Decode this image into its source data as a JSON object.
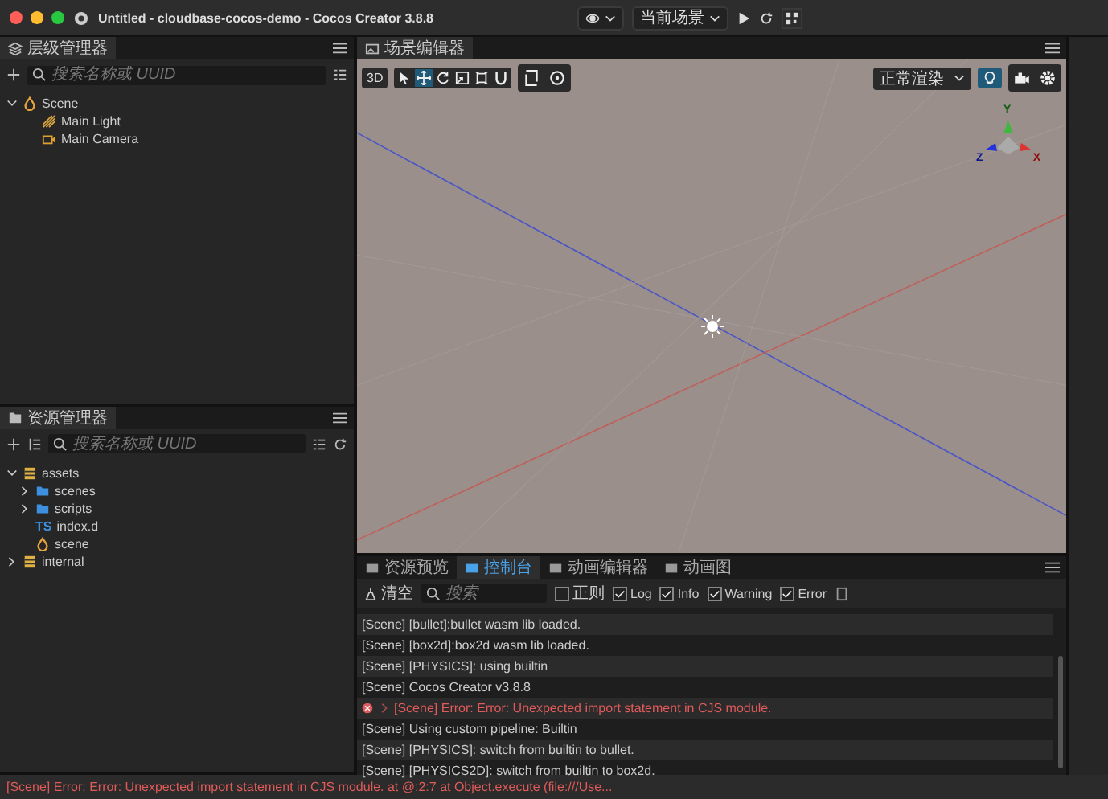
{
  "window": {
    "title": "Untitled - cloudbase-cocos-demo - Cocos Creator 3.8.8",
    "scene_selector": "当前场景"
  },
  "hierarchy": {
    "tab": "层级管理器",
    "search": {
      "placeholder": "搜索名称或 UUID"
    },
    "tree": [
      {
        "label": "Scene",
        "kind": "scene",
        "expanded": true,
        "children": [
          {
            "label": "Main Light",
            "kind": "light"
          },
          {
            "label": "Main Camera",
            "kind": "camera"
          }
        ]
      }
    ]
  },
  "scene_editor": {
    "tab": "场景编辑器",
    "view_toggle": "3D",
    "tools": [
      {
        "selected": false
      },
      {
        "selected": true
      },
      {
        "selected": false
      },
      {
        "selected": false
      },
      {
        "selected": false
      },
      {
        "selected": false
      }
    ],
    "render_mode": "正常渲染",
    "lighting_on": true,
    "gizmo": {
      "y": "Y",
      "z": "Z",
      "x": "X"
    }
  },
  "assets": {
    "tab": "资源管理器",
    "search": {
      "placeholder": "搜索名称或 UUID"
    },
    "tree": [
      {
        "label": "assets",
        "kind": "db",
        "expanded": true,
        "children": [
          {
            "label": "scenes",
            "kind": "folder",
            "expanded": false
          },
          {
            "label": "scripts",
            "kind": "folder",
            "expanded": false
          },
          {
            "label": "index.d",
            "kind": "ts",
            "badge": "TS"
          },
          {
            "label": "scene",
            "kind": "scene"
          }
        ]
      },
      {
        "label": "internal",
        "kind": "db",
        "expanded": false
      }
    ]
  },
  "console": {
    "tabs": [
      {
        "label": "资源预览",
        "selected": false
      },
      {
        "label": "控制台",
        "selected": true
      },
      {
        "label": "动画编辑器",
        "selected": false
      },
      {
        "label": "动画图",
        "selected": false
      }
    ],
    "clear": "清空",
    "search": {
      "placeholder": "搜索"
    },
    "filters": [
      {
        "label": "正则",
        "checked": false
      },
      {
        "label": "Log",
        "checked": true
      },
      {
        "label": "Info",
        "checked": true
      },
      {
        "label": "Warning",
        "checked": true
      },
      {
        "label": "Error",
        "checked": true
      }
    ],
    "logs": [
      {
        "kind": "log",
        "text": "[Scene] [bullet]:bullet wasm lib loaded."
      },
      {
        "kind": "log",
        "text": "[Scene] [box2d]:box2d wasm lib loaded."
      },
      {
        "kind": "log",
        "text": "[Scene] [PHYSICS]: using builtin"
      },
      {
        "kind": "log",
        "text": "[Scene] Cocos Creator v3.8.8"
      },
      {
        "kind": "error",
        "text": "[Scene] Error: Error: Unexpected import statement in CJS module."
      },
      {
        "kind": "log",
        "text": "[Scene] Using custom pipeline: Builtin"
      },
      {
        "kind": "log",
        "text": "[Scene] [PHYSICS]: switch from builtin to bullet."
      },
      {
        "kind": "log",
        "text": "[Scene] [PHYSICS2D]: switch from builtin to box2d."
      }
    ]
  },
  "status_bar": {
    "message": "[Scene] Error: Error: Unexpected import statement in CJS module. at @:2:7 at Object.execute (file:///Use..."
  }
}
